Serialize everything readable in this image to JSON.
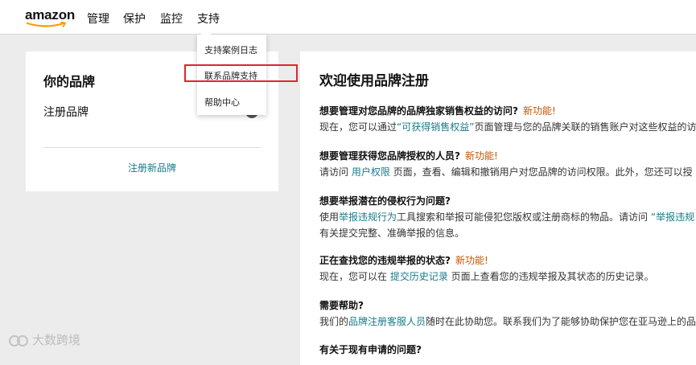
{
  "header": {
    "logo_text": "amazon",
    "nav": [
      "管理",
      "保护",
      "监控",
      "支持"
    ]
  },
  "dropdown": {
    "items": [
      "支持案例日志",
      "联系品牌支持",
      "帮助中心"
    ]
  },
  "left_panel": {
    "title": "你的品牌",
    "brand_label": "注册品牌",
    "register_link": "注册新品牌"
  },
  "right_panel": {
    "title": "欢迎使用品牌注册",
    "new_badge": "新功能!",
    "sections": [
      {
        "question": "想要管理对您品牌的品牌独家销售权益的访问?",
        "answer_pre": "现在，您可以通过",
        "answer_link": "“可获得销售权益”",
        "answer_post": "页面管理与您的品牌关联的销售账户对这些权益的访"
      },
      {
        "question": "想要管理获得您品牌授权的人员?",
        "answer_pre": "请访问 ",
        "answer_link": "用户权限",
        "answer_post": " 页面，查看、编辑和撤销用户对您品牌的访问权限。此外，您还可以授"
      },
      {
        "question": "想要举报潜在的侵权行为问题?",
        "answer_pre": "使用",
        "answer_link": "举报违规行为",
        "answer_post": "工具搜索和举报可能侵犯您版权或注册商标的物品。请访问 ",
        "answer_link2": "“举报违规",
        "answer_line2": "有关提交完整、准确举报的信息。"
      },
      {
        "question": "正在查找您的违规举报的状态?",
        "answer_pre": "现在，您可以在 ",
        "answer_link": "提交历史记录",
        "answer_post": " 页面上查看您的违规举报及其状态的历史记录。"
      },
      {
        "question": "需要帮助?",
        "answer_pre": "我们的",
        "answer_link": "品牌注册客服人员",
        "answer_post": "随时在此协助您。联系我们为了能够协助保护您在亚马逊上的品"
      },
      {
        "question": "有关于现有申请的问题?"
      }
    ]
  },
  "watermark": "大数跨境",
  "colors": {
    "link": "#1a7a8a",
    "new_badge": "#c45500",
    "highlight": "#e0262c"
  }
}
